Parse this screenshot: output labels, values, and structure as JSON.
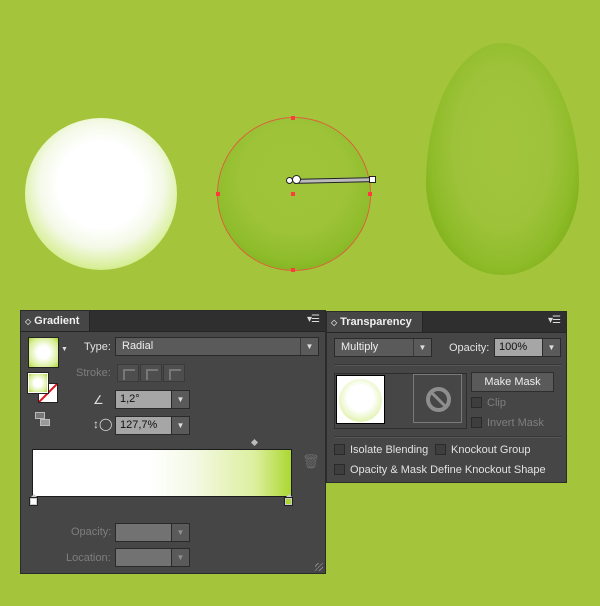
{
  "colors": {
    "canvas_bg": "#a4c43b",
    "panel_bg": "#464646",
    "gradient_start": "#ffffff",
    "gradient_end": "#acd731",
    "anchor_color": "#ff3b3b"
  },
  "artwork": {
    "objects": [
      "white-green radial sphere",
      "green radial sphere (selected)",
      "green egg"
    ]
  },
  "gradient_panel": {
    "tab_label": "Gradient",
    "type_label": "Type:",
    "type_value": "Radial",
    "stroke_label": "Stroke:",
    "angle_value": "1,2°",
    "aspect_value": "127,7%",
    "opacity_label": "Opacity:",
    "opacity_value": "",
    "location_label": "Location:",
    "location_value": "",
    "icons": {
      "angle": "angle-icon",
      "aspect": "aspect-ratio-icon",
      "delete": "trash-icon",
      "menu": "panel-menu-icon"
    },
    "stops": [
      {
        "color": "#ffffff",
        "location": 0
      },
      {
        "color": "#acd731",
        "location": 100
      }
    ],
    "midpoint": 86
  },
  "transparency_panel": {
    "tab_label": "Transparency",
    "blend_mode": "Multiply",
    "opacity_label": "Opacity:",
    "opacity_value": "100%",
    "make_mask_label": "Make Mask",
    "clip_label": "Clip",
    "invert_mask_label": "Invert Mask",
    "isolate_blending_label": "Isolate Blending",
    "knockout_group_label": "Knockout Group",
    "knockout_shape_label": "Opacity & Mask Define Knockout Shape"
  }
}
